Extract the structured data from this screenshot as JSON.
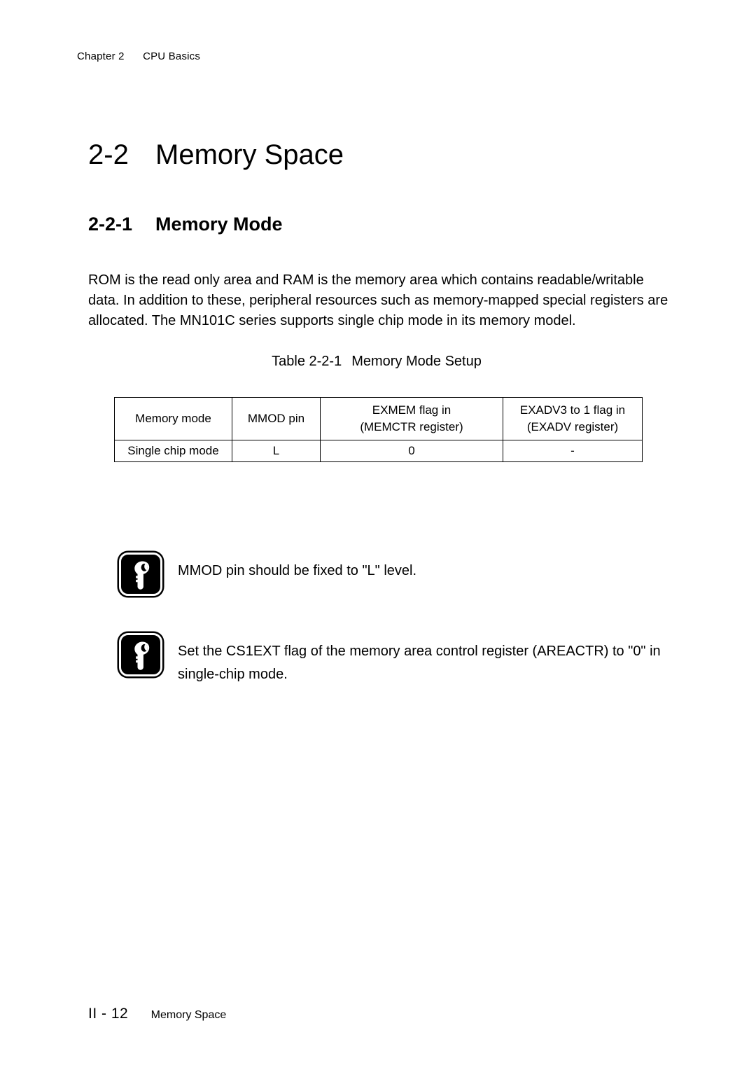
{
  "header": {
    "chapter_number": "Chapter 2",
    "chapter_title": "CPU Basics"
  },
  "section": {
    "number": "2-2",
    "title": "Memory Space"
  },
  "subsection": {
    "number": "2-2-1",
    "title": "Memory Mode"
  },
  "body": {
    "paragraph": "ROM is the read only area and RAM is the memory area which contains readable/writable data. In addition to these, peripheral resources such as memory-mapped special registers are allocated. The MN101C series supports single chip mode in its memory model."
  },
  "table": {
    "caption_number": "Table 2-2-1",
    "caption_title": "Memory Mode Setup",
    "columns": [
      {
        "line1": "Memory mode",
        "line2": ""
      },
      {
        "line1": "MMOD pin",
        "line2": ""
      },
      {
        "line1": "EXMEM flag in",
        "line2": "(MEMCTR register)"
      },
      {
        "line1": "EXADV3 to 1 flag in",
        "line2": "(EXADV register)"
      }
    ],
    "rows": [
      {
        "memory_mode": "Single chip mode",
        "mmod_pin": "L",
        "exmem_flag": "0",
        "exadv_flag": "-"
      }
    ]
  },
  "notes": [
    {
      "icon": "key-icon",
      "text": "MMOD pin should be fixed to \"L\" level."
    },
    {
      "icon": "key-icon",
      "text": "Set the CS1EXT flag of the memory area control register (AREACTR) to \"0\" in single-chip mode."
    }
  ],
  "footer": {
    "folio": "II - 12",
    "title": "Memory Space"
  }
}
